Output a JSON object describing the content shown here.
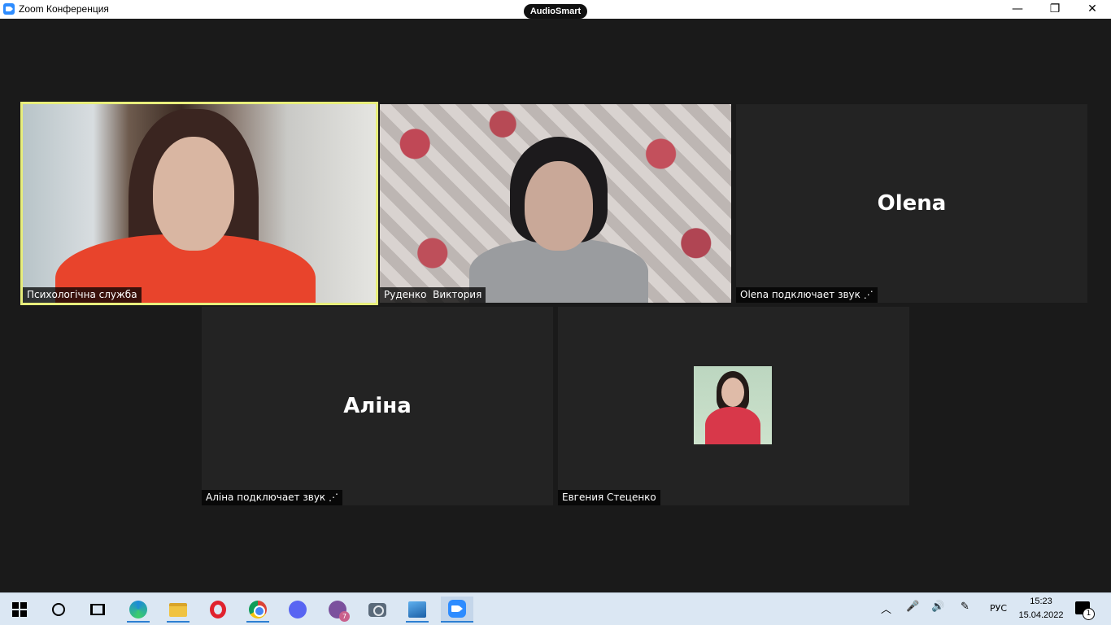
{
  "window": {
    "title": "Zoom Конференция",
    "overlay_badge": "AudioSmart",
    "minimize_glyph": "—",
    "maximize_glyph": "❐",
    "close_glyph": "✕"
  },
  "participants": [
    {
      "name": "Психологічна служба",
      "video": true,
      "active_speaker": true
    },
    {
      "name": "Руденко  Виктория",
      "video": true,
      "active_speaker": false
    },
    {
      "name": "Olena",
      "label": "Olena подключает звук ⋰",
      "video": false,
      "active_speaker": false
    },
    {
      "name": "Аліна",
      "label": "Аліна подключает звук ⋰",
      "video": false,
      "active_speaker": false
    },
    {
      "name": "Евгения Стеценко",
      "video": false,
      "avatar": true,
      "active_speaker": false
    }
  ],
  "colors": {
    "active_speaker_border": "#e8ee7c",
    "tile_background": "#232323",
    "meeting_background": "#1a1a1a",
    "taskbar": "#dbe7f3"
  },
  "taskbar": {
    "apps": [
      {
        "icon": "windows-start-icon"
      },
      {
        "icon": "search-icon"
      },
      {
        "icon": "task-view-icon"
      },
      {
        "icon": "edge-icon"
      },
      {
        "icon": "file-explorer-icon"
      },
      {
        "icon": "opera-icon"
      },
      {
        "icon": "chrome-icon"
      },
      {
        "icon": "discord-icon"
      },
      {
        "icon": "viber-icon",
        "badge": "7"
      },
      {
        "icon": "camera-icon"
      },
      {
        "icon": "photos-icon"
      },
      {
        "icon": "zoom-icon",
        "active": true
      }
    ],
    "tray": {
      "chevron": "︿",
      "mic": "🎤",
      "volume": "🔊",
      "pen": "✎",
      "language": "РУС",
      "time": "15:23",
      "date": "15.04.2022",
      "notification_count": "1"
    }
  }
}
